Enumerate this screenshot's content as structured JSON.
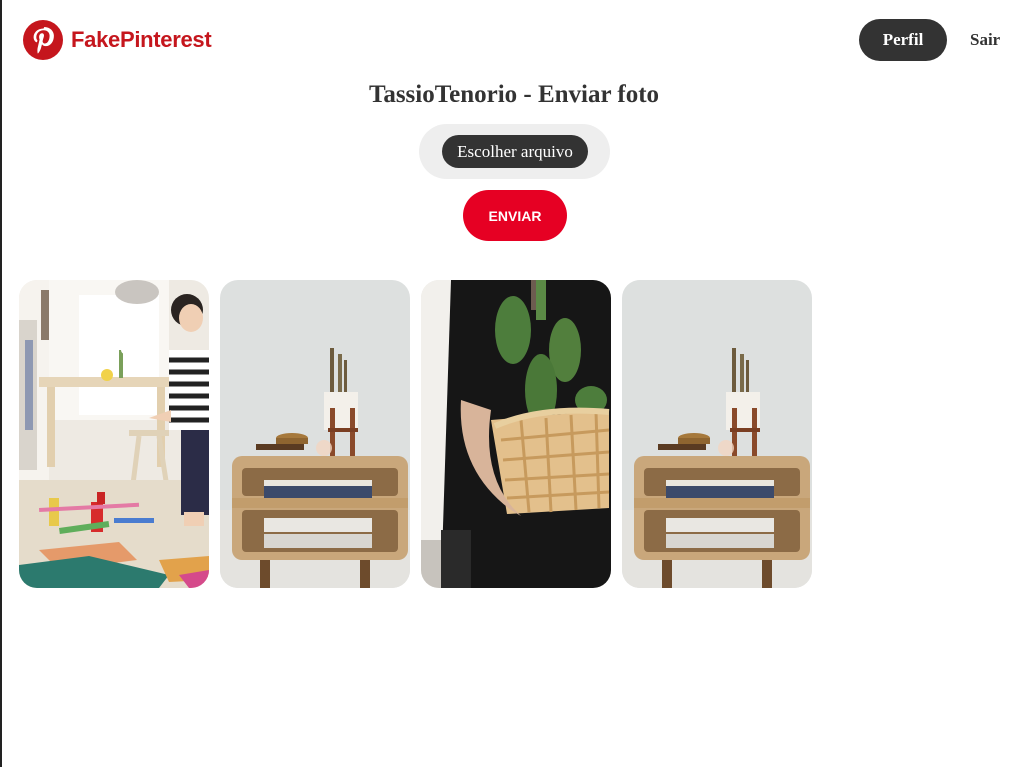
{
  "header": {
    "brand": "FakePinterest",
    "brand_color": "#c5161d",
    "logo_icon": "pinterest-logo-icon",
    "nav": {
      "perfil_label": "Perfil",
      "sair_label": "Sair"
    }
  },
  "main": {
    "title": "TassioTenorio - Enviar foto",
    "file_button_label": "Escolher arquivo",
    "submit_label": "ENVIAR",
    "submit_color": "#e60023"
  },
  "gallery": {
    "photos": [
      {
        "alt": "child-playing-room"
      },
      {
        "alt": "wooden-nightstand-cactus"
      },
      {
        "alt": "person-holding-cactus-basket"
      },
      {
        "alt": "wooden-nightstand-cactus"
      }
    ]
  }
}
